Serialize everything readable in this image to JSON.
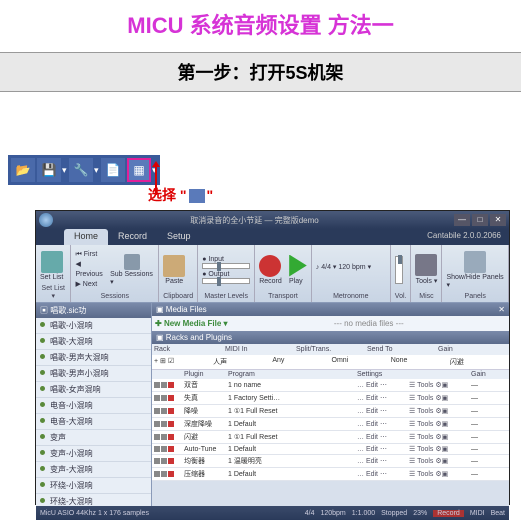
{
  "page": {
    "title": "MICU  系统音频设置 方法一",
    "step": "第一步：打开5S机架",
    "select_label": "选择 \"",
    "select_label2": "\""
  },
  "titlebar": {
    "text": "取消录音的全小节延 — 完整版demo",
    "app_label": "Cantabile 2.0.0.2066"
  },
  "tabs": {
    "home": "Home",
    "record": "Record",
    "setup": "Setup"
  },
  "ribbon": {
    "set": {
      "label": "Set List ▾",
      "btn": "Set List"
    },
    "sess": {
      "first": "⏮ First",
      "prev": "◀ Previous",
      "next": "▶ Next",
      "sub": "Sub Sessions ▾",
      "label": "Sessions"
    },
    "clip": {
      "paste": "Paste",
      "label": "Clipboard"
    },
    "master": {
      "in": "● Input",
      "out": "● Output",
      "label": "Master Levels"
    },
    "trans": {
      "rec": "Record",
      "play": "Play",
      "label": "Transport"
    },
    "metro": {
      "ts": "4/4",
      "bpm": "120 bpm",
      "label": "Metronome"
    },
    "vol": {
      "label": "Vol."
    },
    "tools": {
      "btn": "Tools ▾",
      "label": "Misc"
    },
    "panels": {
      "btn": "Show/Hide Panels ▾",
      "label": "Panels"
    }
  },
  "left": {
    "head": "▣ 唱歌.sic功",
    "items": [
      "唱歌-小混响",
      "唱歌-大混响",
      "唱歌-男声大混响",
      "唱歌-男声小混响",
      "唱歌-女声混响",
      "电音-小混响",
      "电音-大混响",
      "变声",
      "变声-小混响",
      "变声-大混响",
      "环绕-小混响",
      "环绕-大混响"
    ]
  },
  "media": {
    "head": "▣ Media Files",
    "new": "New Media File ▾",
    "none": "--- no media files ---"
  },
  "rack": {
    "head": "▣ Racks and Plugins",
    "cols": {
      "rack": "Rack",
      "midi": "MIDI In",
      "split": "Split/Trans.",
      "send": "Send To",
      "gain": "Gain"
    },
    "row": {
      "c1": "+ ⊞ ☑",
      "name": "人声",
      "midi": "Any",
      "ch": "Omni",
      "split": "None",
      "send": "闪避"
    },
    "pcols": {
      "a": "",
      "plugin": "Plugin",
      "program": "Program",
      "settings": "Settings",
      "tools": "",
      "gain": "Gain"
    },
    "plugins": [
      {
        "name": "双音",
        "prog": "1 no name",
        "set": "Edit ⋯",
        "tools": "☰ Tools ⚙▣"
      },
      {
        "name": "失真",
        "prog": "1 Factory Setti…",
        "set": "Edit ⋯",
        "tools": "☰ Tools ⚙▣"
      },
      {
        "name": "降噪",
        "prog": "1 ①1 Full Reset",
        "set": "Edit ⋯",
        "tools": "☰ Tools ⚙▣"
      },
      {
        "name": "深度降噪",
        "prog": "1 Default",
        "set": "Edit ⋯",
        "tools": "☰ Tools ⚙▣"
      },
      {
        "name": "闪避",
        "prog": "1 ①1 Full Reset",
        "set": "Edit ⋯",
        "tools": "☰ Tools ⚙▣"
      },
      {
        "name": "Auto-Tune",
        "prog": "1 Default",
        "set": "Edit ⋯",
        "tools": "☰ Tools ⚙▣"
      },
      {
        "name": "均衡器",
        "prog": "1 温暖明亮",
        "set": "Edit ⋯",
        "tools": "☰ Tools ⚙▣"
      },
      {
        "name": "压缩器",
        "prog": "1 Default",
        "set": "Edit ⋯",
        "tools": "☰ Tools ⚙▣"
      }
    ]
  },
  "status": {
    "driver": "MicU ASIO 44Khz 1 x 176 samples",
    "ts": "4/4",
    "bpm": "120bpm",
    "pos": "1:1.000",
    "state": "Stopped",
    "pct": "23%",
    "rec": "Record",
    "m1": "MIDI",
    "m2": "Beat"
  }
}
